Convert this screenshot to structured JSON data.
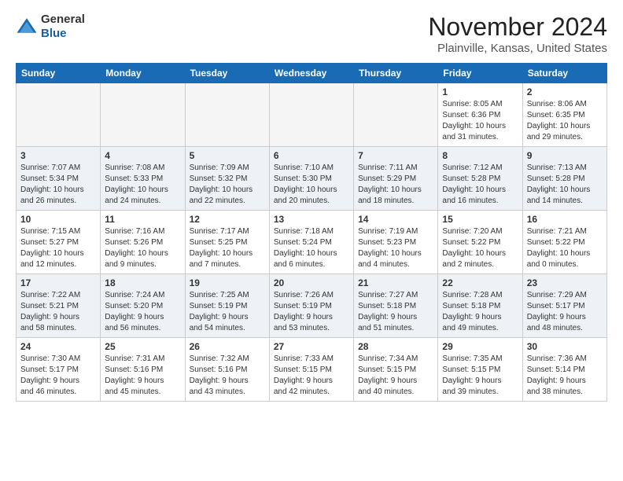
{
  "header": {
    "logo": {
      "line1": "General",
      "line2": "Blue"
    },
    "month": "November 2024",
    "location": "Plainville, Kansas, United States"
  },
  "weekdays": [
    "Sunday",
    "Monday",
    "Tuesday",
    "Wednesday",
    "Thursday",
    "Friday",
    "Saturday"
  ],
  "weeks": [
    [
      {
        "day": "",
        "info": ""
      },
      {
        "day": "",
        "info": ""
      },
      {
        "day": "",
        "info": ""
      },
      {
        "day": "",
        "info": ""
      },
      {
        "day": "",
        "info": ""
      },
      {
        "day": "1",
        "info": "Sunrise: 8:05 AM\nSunset: 6:36 PM\nDaylight: 10 hours\nand 31 minutes."
      },
      {
        "day": "2",
        "info": "Sunrise: 8:06 AM\nSunset: 6:35 PM\nDaylight: 10 hours\nand 29 minutes."
      }
    ],
    [
      {
        "day": "3",
        "info": "Sunrise: 7:07 AM\nSunset: 5:34 PM\nDaylight: 10 hours\nand 26 minutes."
      },
      {
        "day": "4",
        "info": "Sunrise: 7:08 AM\nSunset: 5:33 PM\nDaylight: 10 hours\nand 24 minutes."
      },
      {
        "day": "5",
        "info": "Sunrise: 7:09 AM\nSunset: 5:32 PM\nDaylight: 10 hours\nand 22 minutes."
      },
      {
        "day": "6",
        "info": "Sunrise: 7:10 AM\nSunset: 5:30 PM\nDaylight: 10 hours\nand 20 minutes."
      },
      {
        "day": "7",
        "info": "Sunrise: 7:11 AM\nSunset: 5:29 PM\nDaylight: 10 hours\nand 18 minutes."
      },
      {
        "day": "8",
        "info": "Sunrise: 7:12 AM\nSunset: 5:28 PM\nDaylight: 10 hours\nand 16 minutes."
      },
      {
        "day": "9",
        "info": "Sunrise: 7:13 AM\nSunset: 5:28 PM\nDaylight: 10 hours\nand 14 minutes."
      }
    ],
    [
      {
        "day": "10",
        "info": "Sunrise: 7:15 AM\nSunset: 5:27 PM\nDaylight: 10 hours\nand 12 minutes."
      },
      {
        "day": "11",
        "info": "Sunrise: 7:16 AM\nSunset: 5:26 PM\nDaylight: 10 hours\nand 9 minutes."
      },
      {
        "day": "12",
        "info": "Sunrise: 7:17 AM\nSunset: 5:25 PM\nDaylight: 10 hours\nand 7 minutes."
      },
      {
        "day": "13",
        "info": "Sunrise: 7:18 AM\nSunset: 5:24 PM\nDaylight: 10 hours\nand 6 minutes."
      },
      {
        "day": "14",
        "info": "Sunrise: 7:19 AM\nSunset: 5:23 PM\nDaylight: 10 hours\nand 4 minutes."
      },
      {
        "day": "15",
        "info": "Sunrise: 7:20 AM\nSunset: 5:22 PM\nDaylight: 10 hours\nand 2 minutes."
      },
      {
        "day": "16",
        "info": "Sunrise: 7:21 AM\nSunset: 5:22 PM\nDaylight: 10 hours\nand 0 minutes."
      }
    ],
    [
      {
        "day": "17",
        "info": "Sunrise: 7:22 AM\nSunset: 5:21 PM\nDaylight: 9 hours\nand 58 minutes."
      },
      {
        "day": "18",
        "info": "Sunrise: 7:24 AM\nSunset: 5:20 PM\nDaylight: 9 hours\nand 56 minutes."
      },
      {
        "day": "19",
        "info": "Sunrise: 7:25 AM\nSunset: 5:19 PM\nDaylight: 9 hours\nand 54 minutes."
      },
      {
        "day": "20",
        "info": "Sunrise: 7:26 AM\nSunset: 5:19 PM\nDaylight: 9 hours\nand 53 minutes."
      },
      {
        "day": "21",
        "info": "Sunrise: 7:27 AM\nSunset: 5:18 PM\nDaylight: 9 hours\nand 51 minutes."
      },
      {
        "day": "22",
        "info": "Sunrise: 7:28 AM\nSunset: 5:18 PM\nDaylight: 9 hours\nand 49 minutes."
      },
      {
        "day": "23",
        "info": "Sunrise: 7:29 AM\nSunset: 5:17 PM\nDaylight: 9 hours\nand 48 minutes."
      }
    ],
    [
      {
        "day": "24",
        "info": "Sunrise: 7:30 AM\nSunset: 5:17 PM\nDaylight: 9 hours\nand 46 minutes."
      },
      {
        "day": "25",
        "info": "Sunrise: 7:31 AM\nSunset: 5:16 PM\nDaylight: 9 hours\nand 45 minutes."
      },
      {
        "day": "26",
        "info": "Sunrise: 7:32 AM\nSunset: 5:16 PM\nDaylight: 9 hours\nand 43 minutes."
      },
      {
        "day": "27",
        "info": "Sunrise: 7:33 AM\nSunset: 5:15 PM\nDaylight: 9 hours\nand 42 minutes."
      },
      {
        "day": "28",
        "info": "Sunrise: 7:34 AM\nSunset: 5:15 PM\nDaylight: 9 hours\nand 40 minutes."
      },
      {
        "day": "29",
        "info": "Sunrise: 7:35 AM\nSunset: 5:15 PM\nDaylight: 9 hours\nand 39 minutes."
      },
      {
        "day": "30",
        "info": "Sunrise: 7:36 AM\nSunset: 5:14 PM\nDaylight: 9 hours\nand 38 minutes."
      }
    ]
  ]
}
